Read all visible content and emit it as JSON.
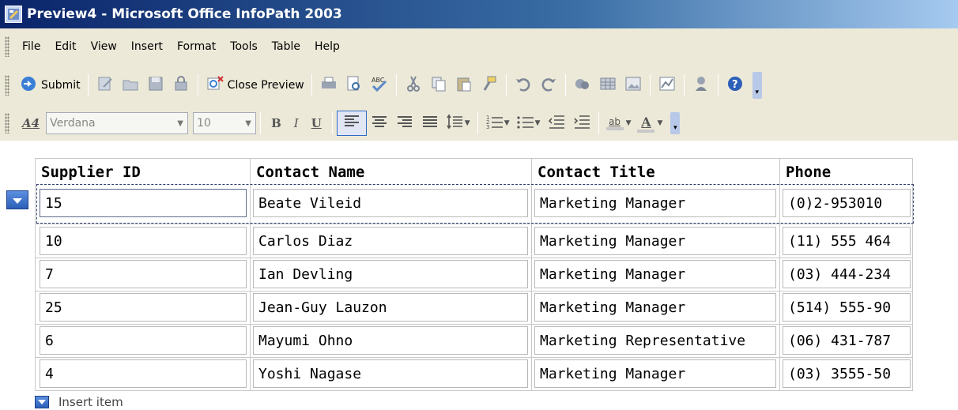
{
  "window": {
    "title": "Preview4 - Microsoft Office InfoPath 2003"
  },
  "menubar": {
    "items": [
      "File",
      "Edit",
      "View",
      "Insert",
      "Format",
      "Tools",
      "Table",
      "Help"
    ]
  },
  "toolbar": {
    "submit_label": "Submit",
    "close_preview_label": "Close Preview",
    "icons": [
      "submit-icon",
      "edit-form-icon",
      "open-icon",
      "save-icon",
      "permission-icon",
      "close-preview-icon",
      "print-icon",
      "print-preview-icon",
      "spelling-icon",
      "cut-icon",
      "copy-icon",
      "paste-icon",
      "format-painter-icon",
      "undo-icon",
      "redo-icon",
      "hyperlink-icon",
      "table-icon",
      "picture-icon",
      "chart-icon",
      "research-icon",
      "help-icon"
    ]
  },
  "formatting": {
    "font_name": "Verdana",
    "font_size": "10",
    "bold": "B",
    "italic": "I",
    "underline": "U",
    "highlight_label": "ab",
    "font_color_label": "A"
  },
  "table": {
    "columns": [
      "Supplier ID",
      "Contact Name",
      "Contact Title",
      "Phone"
    ],
    "rows": [
      [
        "15",
        "Beate Vileid",
        "Marketing Manager",
        "(0)2-953010"
      ],
      [
        "10",
        "Carlos Diaz",
        "Marketing Manager",
        "(11) 555 464"
      ],
      [
        "7",
        "Ian Devling",
        "Marketing Manager",
        "(03) 444-234"
      ],
      [
        "25",
        "Jean-Guy Lauzon",
        "Marketing Manager",
        "(514) 555-90"
      ],
      [
        "6",
        "Mayumi Ohno",
        "Marketing Representative",
        "(06) 431-787"
      ],
      [
        "4",
        "Yoshi Nagase",
        "Marketing Manager",
        "(03) 3555-50"
      ]
    ]
  },
  "insert_item_label": "Insert item",
  "colors": {
    "titlebar_start": "#0a246a",
    "titlebar_end": "#a6caf0",
    "toolbar_bg": "#ece9d8",
    "handle_blue": "#2c5fb8"
  }
}
